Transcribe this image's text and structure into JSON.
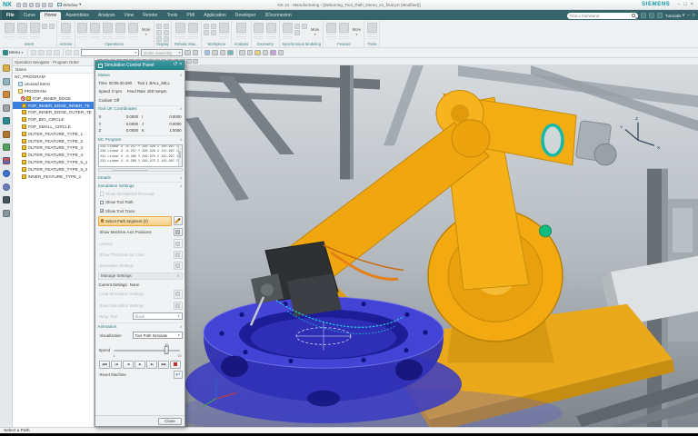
{
  "titlebar": {
    "app_logo": "NX",
    "window_menu": "Window",
    "title": "NX 12 - Manufacturing - [Deburring_Tool_Path_Demo_v2_final.prt (Modified)]",
    "brand": "SIEMENS"
  },
  "tabbar": {
    "tabs": [
      {
        "label": "File"
      },
      {
        "label": "Curve"
      },
      {
        "label": "Home"
      },
      {
        "label": "Assemblies"
      },
      {
        "label": "Analysis"
      },
      {
        "label": "View"
      },
      {
        "label": "Render"
      },
      {
        "label": "Tools"
      },
      {
        "label": "PMI"
      },
      {
        "label": "Application"
      },
      {
        "label": "Developer"
      },
      {
        "label": "3Dconnexion"
      }
    ],
    "active_tab": "Home",
    "search_placeholder": "Find a Command",
    "tutorials_label": "Tutorials"
  },
  "ribbon": {
    "groups": [
      "Insert",
      "Actions",
      "Operations",
      "Display",
      "Robotic Mac...",
      "Workpiece",
      "Analysis",
      "Geometry",
      "Synchronous Modeling",
      "Feature",
      "Tools"
    ],
    "more_label": "More"
  },
  "toolbar": {
    "menu_label": "Menu",
    "selection_filter_value": "",
    "selection_scope_value": "Entire Assembly"
  },
  "navigator": {
    "title": "Operation Navigator - Program Order",
    "name_column": "Name",
    "items": [
      {
        "label": "NC_PROGRAM"
      },
      {
        "label": "Unused Items"
      },
      {
        "label": "PROGRAM"
      },
      {
        "label": "TOP_INNER_EDGE"
      },
      {
        "label": "TOP_INNER_EDGE_INNER_TE"
      },
      {
        "label": "TOP_INNER_EDGE_OUTER_TE"
      },
      {
        "label": "TOP_BIG_CIRCLE"
      },
      {
        "label": "TOP_SMALL_CIRCLE"
      },
      {
        "label": "OUTER_FEATURE_TYPE_1"
      },
      {
        "label": "OUTER_FEATURE_TYPE_2"
      },
      {
        "label": "OUTER_FEATURE_TYPE_3"
      },
      {
        "label": "OUTER_FEATURE_TYPE_4"
      },
      {
        "label": "OUTER_FEATURE_TYPE_5_1"
      },
      {
        "label": "OUTER_FEATURE_TYPE_5_2"
      },
      {
        "label": "INNER_FEATURE_TYPE_1"
      }
    ]
  },
  "panel": {
    "title": "Simulation Control Panel",
    "status": {
      "header": "Status",
      "time_label": "Time",
      "time_value": "00:06:20.280",
      "tool_label": "Tool 1",
      "tool_value": "BALL_MILL",
      "speed_label": "Speed",
      "speed_value": "0 rpm",
      "feed_label": "Feed Rate",
      "feed_value": "250 mmpm",
      "coolant_label": "Coolant",
      "coolant_value": "Off"
    },
    "ijk": {
      "header": "Tool IJK Coordinates",
      "x_label": "X",
      "x": "0.0000",
      "i_label": "I",
      "i": "0.0000",
      "y_label": "Y",
      "y": "0.0000",
      "j_label": "J",
      "j": "0.0000",
      "z_label": "Z",
      "z": "0.0000",
      "k_label": "K",
      "k": "1.0000"
    },
    "nc": {
      "header": "NC Program",
      "lines": [
        {
          "text": "229 Linear X -8.257 Y 246.320 Z 140.997 I 0.00 J"
        },
        {
          "text": "230 Linear X -8.257 Y 246.320 Z 141.997 I 0.00 J"
        },
        {
          "text": "231 Linear X -8.260 Y 246.975 Z 142.997 I 0.00 J"
        },
        {
          "text": "232 Linear X -8.260 Y 249.975 Z 143.997 I 0.00 J"
        }
      ]
    },
    "details_header": "Details",
    "sim": {
      "header": "Simulation Settings",
      "cb1": "Show 3D Material Removal",
      "cb1_check": "",
      "cb2": "Show Tool Path",
      "cb2_check": "",
      "cb3": "Show Tool Trace",
      "cb3_check": "✓",
      "select_path": "Select Path Segment (0)",
      "show_axis": "Show Machine Axis Positions",
      "unload": "Unload",
      "thickness": "Show Thickness by Color",
      "settings": "Simulation Settings"
    },
    "manage": {
      "header": "Manage Settings",
      "current_label": "Current Settings:",
      "current_value": "None",
      "load": "Load Simulation Settings",
      "save": "Save Simulation Settings",
      "wrap_label": "Wrap Text",
      "wrap_value": "Blank"
    },
    "animation": {
      "header": "Animation",
      "visualization_label": "Visualization",
      "visualization_value": "Tool Path Simulate",
      "speed_label": "Speed",
      "speed_value": "10",
      "speed_min": "1",
      "speed_max": "10",
      "reset_label": "Reset Machine"
    },
    "close_label": "Close"
  },
  "viewport": {
    "triad": {
      "x": "X",
      "y": "Y",
      "z": "Z"
    }
  },
  "statusbar": {
    "message": "Select a Path"
  },
  "icons": {
    "minimize": "–",
    "maximize": "□",
    "close": "×",
    "panel_reset": "↺",
    "panel_close": "×",
    "collapse": "∧",
    "expand": "∨",
    "dropdown": "▾",
    "reset_arrow": "↩",
    "playback": [
      {
        "glyph": "|◀◀"
      },
      {
        "glyph": "|◀"
      },
      {
        "glyph": "◀"
      },
      {
        "glyph": "▶"
      },
      {
        "glyph": "▶|"
      },
      {
        "glyph": "▶▶|"
      }
    ]
  },
  "colors": {
    "brand_teal": "#0d9aa2",
    "ribbon_bar": "#36646a",
    "panel_header": "#25828a",
    "selection_blue": "#3c7edc",
    "highlight_orange": "#eda93e",
    "robot_yellow": "#f2aa10",
    "fixture_blue": "#3434c0",
    "stop_red": "#d22a24"
  }
}
